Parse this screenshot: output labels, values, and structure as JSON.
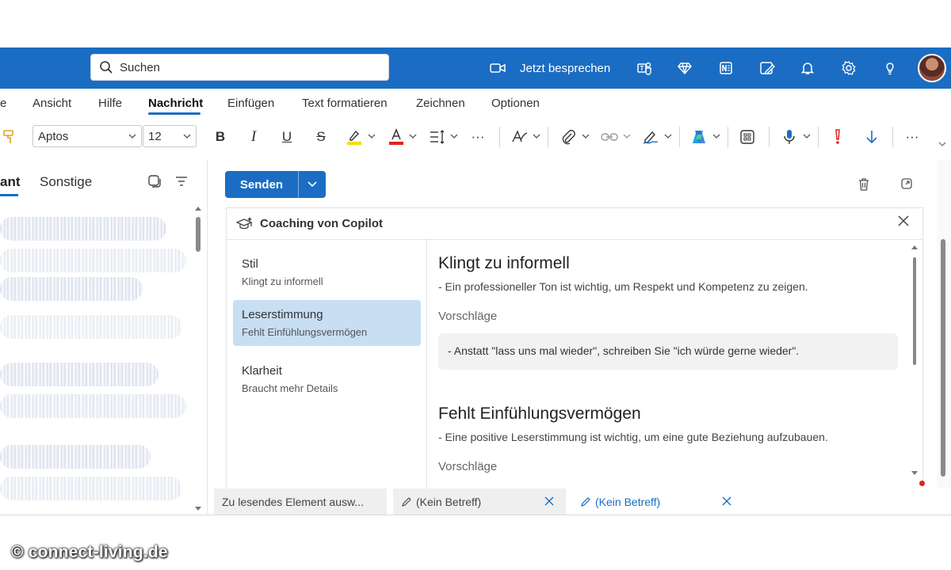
{
  "search": {
    "placeholder": "Suchen"
  },
  "topbar": {
    "meet_label": "Jetzt besprechen"
  },
  "ribbon": {
    "tabs": [
      {
        "label": "e"
      },
      {
        "label": "Ansicht"
      },
      {
        "label": "Hilfe"
      },
      {
        "label": "Nachricht"
      },
      {
        "label": "Einfügen"
      },
      {
        "label": "Text formatieren"
      },
      {
        "label": "Zeichnen"
      },
      {
        "label": "Optionen"
      }
    ]
  },
  "toolbar": {
    "font": "Aptos",
    "size": "12",
    "bold": "B",
    "italic": "I",
    "underline": "U",
    "strike": "S",
    "more": "···"
  },
  "leftpane": {
    "tab_focused": "ant",
    "tab_other": "Sonstige"
  },
  "compose": {
    "send_label": "Senden"
  },
  "coaching": {
    "title": "Coaching von Copilot",
    "nav": [
      {
        "title": "Stil",
        "subtitle": "Klingt zu informell"
      },
      {
        "title": "Leserstimmung",
        "subtitle": "Fehlt Einfühlungsvermögen"
      },
      {
        "title": "Klarheit",
        "subtitle": "Braucht mehr Details"
      }
    ],
    "sections": [
      {
        "heading": "Klingt zu informell",
        "text": "- Ein professioneller Ton ist wichtig, um Respekt und Kompetenz zu zeigen.",
        "suggestions_label": "Vorschläge",
        "suggestion": "- Anstatt \"lass uns mal wieder\", schreiben Sie \"ich würde gerne wieder\"."
      },
      {
        "heading": "Fehlt Einfühlungsvermögen",
        "text": "- Eine positive Leserstimmung ist wichtig, um eine gute Beziehung aufzubauen.",
        "suggestions_label": "Vorschläge"
      }
    ]
  },
  "bottom_tabs": [
    {
      "label": "Zu lesendes Element ausw..."
    },
    {
      "label": "(Kein Betreff)"
    },
    {
      "label": "(Kein Betreff)"
    }
  ],
  "watermark": "© connect-living.de",
  "colors": {
    "brand": "#1a6dc2",
    "selected_nav": "#c7def3"
  }
}
